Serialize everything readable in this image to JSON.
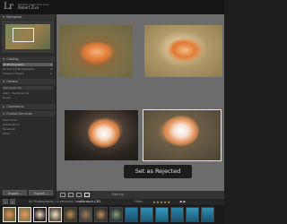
{
  "app": {
    "logo": "Lr",
    "identity_line1": "Identity plate text here",
    "identity_line2": "Robert Ziva"
  },
  "left_panel": {
    "navigator": "Navigator",
    "catalog": {
      "title": "Catalog",
      "items": [
        {
          "label": "All Photographs",
          "count": "1"
        },
        {
          "label": "All Synced Photographs",
          "count": "0"
        },
        {
          "label": "Previous Import",
          "count": "0"
        }
      ]
    },
    "folders": "Folders",
    "hard_drive": {
      "title": "Macintosh HD",
      "items": [
        {
          "label": "2015 · Nudibranchs",
          "count": ""
        },
        {
          "label": "Guam",
          "count": ""
        }
      ]
    },
    "collections": "Collections",
    "publish_services": {
      "title": "Publish Services",
      "items": [
        {
          "label": "Hard Drive",
          "count": ""
        },
        {
          "label": "Adobe Stock",
          "count": ""
        },
        {
          "label": "Facebook",
          "count": ""
        },
        {
          "label": "Flickr",
          "count": ""
        }
      ]
    },
    "import_btn": "Import...",
    "export_btn": "Export..."
  },
  "main": {
    "reject_label": "Set as Rejected"
  },
  "toolbar": {
    "sort_label": "Sort by:"
  },
  "filmstrip": {
    "num1": "1",
    "num2": "2",
    "source_text": "All Photographs",
    "count_text": "4 selected",
    "filename": "nudibranch.CR2",
    "filter_label": "Filter:",
    "stars": "★★★★★",
    "flags": "⚑⚑"
  }
}
